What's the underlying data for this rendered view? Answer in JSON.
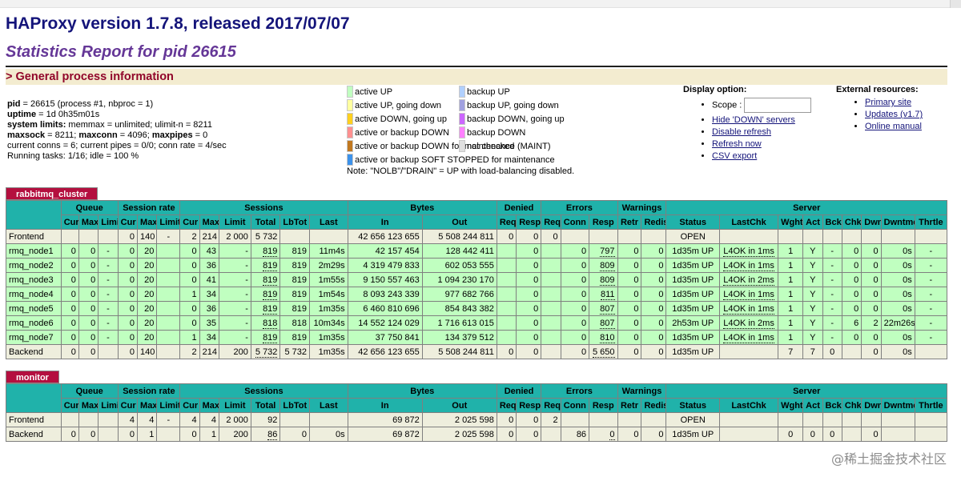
{
  "header": {
    "version": "HAProxy version 1.7.8, released 2017/07/07",
    "report": "Statistics Report for pid 26615",
    "section_title": "> General process information"
  },
  "procinfo": [
    {
      "label": "pid",
      "value": " = 26615 (process #1, nbproc = 1)"
    },
    {
      "label": "uptime",
      "value": " = 1d 0h35m01s"
    },
    {
      "label": "system limits:",
      "value": " memmax = unlimited; ulimit-n = 8211"
    },
    {
      "label": "maxsock",
      "value": " = 8211; ",
      "label2": "maxconn",
      "value2": " = 4096; ",
      "label3": "maxpipes",
      "value3": " = 0"
    },
    {
      "label": "",
      "value": "current conns = 6; current pipes = 0/0; conn rate = 4/sec"
    },
    {
      "label": "",
      "value": "Running tasks: 1/16; idle = 100 %"
    }
  ],
  "legend": {
    "left": [
      {
        "color": "#c0ffc0",
        "text": "active UP"
      },
      {
        "color": "#ffffa0",
        "text": "active UP, going down"
      },
      {
        "color": "#ffd020",
        "text": "active DOWN, going up"
      },
      {
        "color": "#ff9090",
        "text": "active or backup DOWN"
      },
      {
        "color": "#c07820",
        "text": "active or backup DOWN for maintenance (MAINT)"
      },
      {
        "color": "#3d92ea",
        "text": "active or backup SOFT STOPPED for maintenance"
      }
    ],
    "right": [
      {
        "color": "#b0d0ff",
        "text": "backup UP"
      },
      {
        "color": "#a0a0e0",
        "text": "backup UP, going down"
      },
      {
        "color": "#cc66ff",
        "text": "backup DOWN, going up"
      },
      {
        "color": "#ff80ff",
        "text": "backup DOWN"
      },
      {
        "color": "#e0e0e0",
        "text": "not checked"
      }
    ],
    "note": "Note: \"NOLB\"/\"DRAIN\" = UP with load-balancing disabled."
  },
  "display": {
    "title": "Display option:",
    "scope_label": "Scope :",
    "links": [
      "Hide 'DOWN' servers",
      "Disable refresh",
      "Refresh now",
      "CSV export"
    ]
  },
  "external": {
    "title": "External resources:",
    "links": [
      "Primary site",
      "Updates (v1.7)",
      "Online manual"
    ]
  },
  "table_headers": {
    "groups": [
      "Queue",
      "Session rate",
      "Sessions",
      "Bytes",
      "Denied",
      "Errors",
      "Warnings",
      "Server"
    ],
    "sub": [
      "Cur",
      "Max",
      "Limit",
      "Cur",
      "Max",
      "Limit",
      "Cur",
      "Max",
      "Limit",
      "Total",
      "LbTot",
      "Last",
      "In",
      "Out",
      "Req",
      "Resp",
      "Req",
      "Conn",
      "Resp",
      "Retr",
      "Redis",
      "Status",
      "LastChk",
      "Wght",
      "Act",
      "Bck",
      "Chk",
      "Dwn",
      "Dwntme",
      "Thrtle"
    ]
  },
  "proxies": [
    {
      "name": "rabbitmq_cluster",
      "rows": [
        {
          "type": "fe",
          "cells": [
            "Frontend",
            "",
            "",
            "",
            "0",
            "140",
            "-",
            "2",
            "214",
            "2 000",
            "5 732",
            "",
            "",
            "42 656 123 655",
            "5 508 244 811",
            "0",
            "0",
            "0",
            "",
            "",
            "",
            "",
            "OPEN",
            "",
            "",
            "",
            "",
            "",
            "",
            "",
            ""
          ]
        },
        {
          "type": "up",
          "cells": [
            "rmq_node1",
            "0",
            "0",
            "-",
            "0",
            "20",
            "",
            "0",
            "43",
            "-",
            "819",
            "819",
            "11m4s",
            "42 157 454",
            "128 442 411",
            "",
            "0",
            "",
            "0",
            "797",
            "0",
            "0",
            "1d35m UP",
            "L4OK in 1ms",
            "1",
            "Y",
            "-",
            "0",
            "0",
            "0s",
            "-"
          ]
        },
        {
          "type": "up",
          "cells": [
            "rmq_node2",
            "0",
            "0",
            "-",
            "0",
            "20",
            "",
            "0",
            "36",
            "-",
            "819",
            "819",
            "2m29s",
            "4 319 479 833",
            "602 053 555",
            "",
            "0",
            "",
            "0",
            "809",
            "0",
            "0",
            "1d35m UP",
            "L4OK in 1ms",
            "1",
            "Y",
            "-",
            "0",
            "0",
            "0s",
            "-"
          ]
        },
        {
          "type": "up",
          "cells": [
            "rmq_node3",
            "0",
            "0",
            "-",
            "0",
            "20",
            "",
            "0",
            "41",
            "-",
            "819",
            "819",
            "1m55s",
            "9 150 557 463",
            "1 094 230 170",
            "",
            "0",
            "",
            "0",
            "809",
            "0",
            "0",
            "1d35m UP",
            "L4OK in 2ms",
            "1",
            "Y",
            "-",
            "0",
            "0",
            "0s",
            "-"
          ]
        },
        {
          "type": "up",
          "cells": [
            "rmq_node4",
            "0",
            "0",
            "-",
            "0",
            "20",
            "",
            "1",
            "34",
            "-",
            "819",
            "819",
            "1m54s",
            "8 093 243 339",
            "977 682 766",
            "",
            "0",
            "",
            "0",
            "811",
            "0",
            "0",
            "1d35m UP",
            "L4OK in 1ms",
            "1",
            "Y",
            "-",
            "0",
            "0",
            "0s",
            "-"
          ]
        },
        {
          "type": "up",
          "cells": [
            "rmq_node5",
            "0",
            "0",
            "-",
            "0",
            "20",
            "",
            "0",
            "36",
            "-",
            "819",
            "819",
            "1m35s",
            "6 460 810 696",
            "854 843 382",
            "",
            "0",
            "",
            "0",
            "807",
            "0",
            "0",
            "1d35m UP",
            "L4OK in 1ms",
            "1",
            "Y",
            "-",
            "0",
            "0",
            "0s",
            "-"
          ]
        },
        {
          "type": "up",
          "cells": [
            "rmq_node6",
            "0",
            "0",
            "-",
            "0",
            "20",
            "",
            "0",
            "35",
            "-",
            "818",
            "818",
            "10m34s",
            "14 552 124 029",
            "1 716 613 015",
            "",
            "0",
            "",
            "0",
            "807",
            "0",
            "0",
            "2h53m UP",
            "L4OK in 2ms",
            "1",
            "Y",
            "-",
            "6",
            "2",
            "22m26s",
            "-"
          ]
        },
        {
          "type": "up",
          "cells": [
            "rmq_node7",
            "0",
            "0",
            "-",
            "0",
            "20",
            "",
            "1",
            "34",
            "-",
            "819",
            "819",
            "1m35s",
            "37 750 841",
            "134 379 512",
            "",
            "0",
            "",
            "0",
            "810",
            "0",
            "0",
            "1d35m UP",
            "L4OK in 1ms",
            "1",
            "Y",
            "-",
            "0",
            "0",
            "0s",
            "-"
          ]
        },
        {
          "type": "be",
          "cells": [
            "Backend",
            "0",
            "0",
            "",
            "0",
            "140",
            "",
            "2",
            "214",
            "200",
            "5 732",
            "5 732",
            "1m35s",
            "42 656 123 655",
            "5 508 244 811",
            "0",
            "0",
            "",
            "0",
            "5 650",
            "0",
            "0",
            "1d35m UP",
            "",
            "7",
            "7",
            "0",
            "",
            "0",
            "0s",
            ""
          ]
        }
      ]
    },
    {
      "name": "monitor",
      "rows": [
        {
          "type": "fe",
          "cells": [
            "Frontend",
            "",
            "",
            "",
            "4",
            "4",
            "-",
            "4",
            "4",
            "2 000",
            "92",
            "",
            "",
            "69 872",
            "2 025 598",
            "0",
            "0",
            "2",
            "",
            "",
            "",
            "",
            "OPEN",
            "",
            "",
            "",
            "",
            "",
            "",
            "",
            ""
          ]
        },
        {
          "type": "be",
          "cells": [
            "Backend",
            "0",
            "0",
            "",
            "0",
            "1",
            "",
            "0",
            "1",
            "200",
            "86",
            "0",
            "0s",
            "69 872",
            "2 025 598",
            "0",
            "0",
            "",
            "86",
            "0",
            "0",
            "0",
            "1d35m UP",
            "",
            "0",
            "0",
            "0",
            "",
            "0",
            "",
            ""
          ]
        }
      ]
    }
  ],
  "watermark": "@稀土掘金技术社区"
}
